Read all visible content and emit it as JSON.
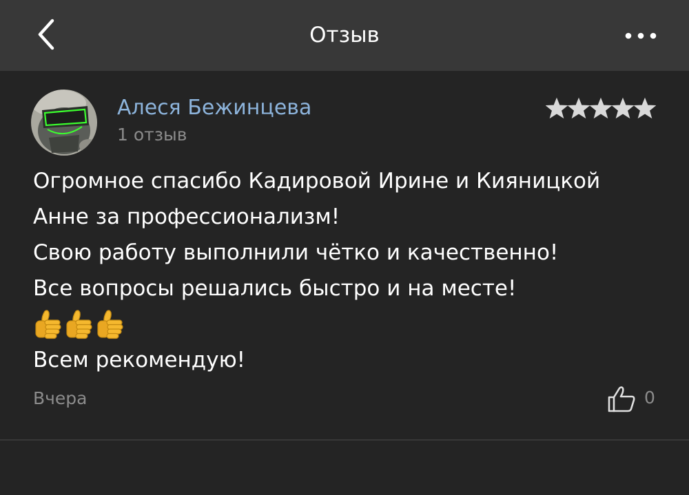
{
  "header": {
    "title": "Отзыв",
    "back_icon": "chevron-left-icon",
    "more_icon": "more-horizontal-icon"
  },
  "review": {
    "author_name": "Алеся Бежинцева",
    "review_count": "1 отзыв",
    "rating": 5,
    "rating_max": 5,
    "text_lines": [
      "Огромное спасибо Кадировой Ирине и Кияницкой",
      "Анне за профессионализм!",
      "Свою работу выполнили чётко и качественно!",
      "Все вопросы решались быстро и на месте!",
      "Всем рекомендую!"
    ],
    "emoji_count": 3,
    "emoji_name": "thumbs-up-emoji",
    "date": "Вчера",
    "likes": "0",
    "like_icon": "thumbs-up-outline-icon"
  },
  "colors": {
    "background": "#242424",
    "header_background": "#383838",
    "author_link": "#8db4dc",
    "secondary_text": "#8c8c8c",
    "star": "#d9d9d9",
    "emoji": "#f5b82e"
  }
}
